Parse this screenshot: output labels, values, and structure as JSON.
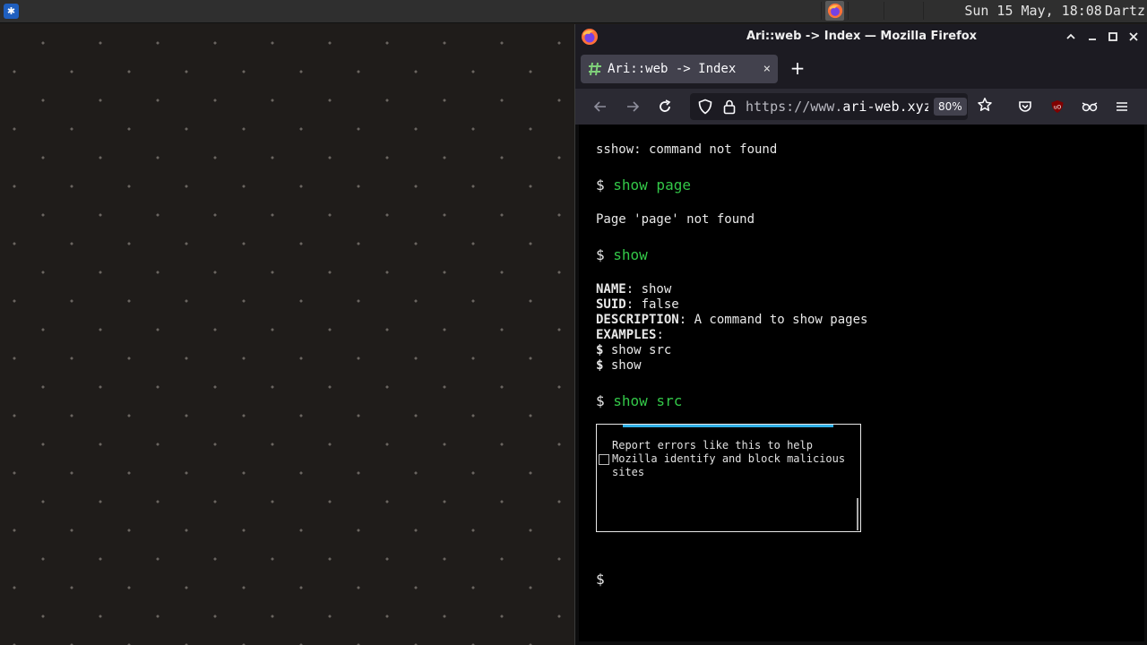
{
  "panel": {
    "clock": "Sun 15 May, 18:08",
    "user": "Dartz"
  },
  "window": {
    "title": "Ari::web -> Index — Mozilla Firefox"
  },
  "tab": {
    "label": "Ari::web -> Index",
    "close": "×",
    "new_tab": "+"
  },
  "navbar": {
    "url_prefix": "https://www.",
    "url_domain": "ari-web.xyz",
    "zoom": "80%"
  },
  "terminal": {
    "line1": "sshow: command not found",
    "cmd1_prompt": "$ ",
    "cmd1": "show page",
    "line2": "Page 'page' not found",
    "cmd2_prompt": "$ ",
    "cmd2": "show",
    "name_key": "NAME",
    "name_val": ": show",
    "suid_key": "SUID",
    "suid_val": ": false",
    "desc_key": "DESCRIPTION",
    "desc_val": ": A command to show pages",
    "examples_key": "EXAMPLES",
    "examples_val": ":",
    "ex1_prompt": "$",
    "ex1": " show src",
    "ex2_prompt": "$",
    "ex2": " show",
    "cmd3_prompt": "$ ",
    "cmd3": "show src",
    "error_report": "Report errors like this to help Mozilla identify and block malicious sites",
    "prompt": "$"
  },
  "colors": {
    "command": "#33c748",
    "accent": "#2fb0e6",
    "terminal_bg": "#000000"
  },
  "icons": [
    "launcher-icon",
    "firefox-icon",
    "shield-icon",
    "lock-icon",
    "star-icon",
    "pocket-icon",
    "ublock-icon",
    "extension-icon",
    "menu-icon"
  ]
}
